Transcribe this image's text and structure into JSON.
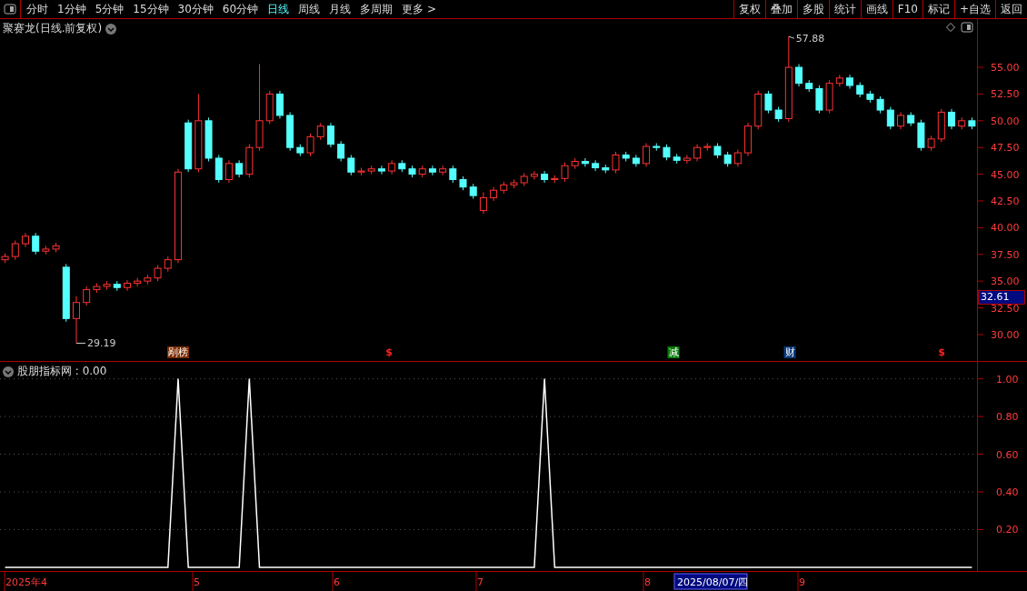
{
  "toolbar": {
    "periods": [
      {
        "label": "分时",
        "selected": false
      },
      {
        "label": "1分钟",
        "selected": false
      },
      {
        "label": "5分钟",
        "selected": false
      },
      {
        "label": "15分钟",
        "selected": false
      },
      {
        "label": "30分钟",
        "selected": false
      },
      {
        "label": "60分钟",
        "selected": false
      },
      {
        "label": "日线",
        "selected": true
      },
      {
        "label": "周线",
        "selected": false
      },
      {
        "label": "月线",
        "selected": false
      },
      {
        "label": "多周期",
        "selected": false
      },
      {
        "label": "更多 >",
        "selected": false
      }
    ],
    "buttons": [
      "复权",
      "叠加",
      "多股",
      "统计",
      "画线",
      "F10",
      "标记",
      "+自选",
      "返回"
    ]
  },
  "price_panel": {
    "title": "聚赛龙(日线.前复权)",
    "high_label": "57.88",
    "low_label": "29.19",
    "events": [
      {
        "label": "剐榜",
        "kind": "list"
      },
      {
        "label": "$",
        "kind": "dollar"
      },
      {
        "label": "减",
        "kind": "reduce"
      },
      {
        "label": "财",
        "kind": "finance"
      },
      {
        "label": "$",
        "kind": "dollar"
      }
    ],
    "current_price": "32.61",
    "chart_data": {
      "type": "candlestick",
      "ylim": [
        27.53,
        59.51
      ],
      "yticks": [
        {
          "value": 55,
          "label": "55.00"
        },
        {
          "value": 52.5,
          "label": "52.50"
        },
        {
          "value": 50,
          "label": "50.00"
        },
        {
          "value": 47.5,
          "label": "47.50"
        },
        {
          "value": 45,
          "label": "45.00"
        },
        {
          "value": 42.5,
          "label": "42.50"
        },
        {
          "value": 40,
          "label": "40.00"
        },
        {
          "value": 37.5,
          "label": "37.50"
        },
        {
          "value": 35,
          "label": "35.00"
        },
        {
          "value": 32.5,
          "label": "32.50"
        },
        {
          "value": 30,
          "label": "30.00"
        }
      ],
      "ohlc": [
        [
          37,
          37.6,
          36.7,
          37.3
        ],
        [
          37.3,
          38.8,
          37.0,
          38.5
        ],
        [
          38.5,
          39.5,
          38.2,
          39.2
        ],
        [
          39.2,
          39.5,
          37.5,
          37.8
        ],
        [
          37.8,
          38.3,
          37.5,
          38.0
        ],
        [
          38.0,
          38.6,
          37.7,
          38.3
        ],
        [
          36.3,
          36.6,
          31.2,
          31.5
        ],
        [
          31.5,
          33.6,
          29.19,
          33.0
        ],
        [
          33.0,
          34.5,
          32.7,
          34.2
        ],
        [
          34.2,
          34.8,
          33.9,
          34.5
        ],
        [
          34.5,
          35.0,
          34.2,
          34.7
        ],
        [
          34.7,
          35.0,
          34.1,
          34.4
        ],
        [
          34.4,
          35.1,
          34.1,
          34.8
        ],
        [
          34.8,
          35.3,
          34.5,
          35.0
        ],
        [
          35.0,
          35.6,
          34.7,
          35.3
        ],
        [
          35.3,
          36.5,
          35.0,
          36.2
        ],
        [
          36.2,
          37.3,
          35.9,
          37.0
        ],
        [
          37.0,
          45.5,
          36.7,
          45.2
        ],
        [
          49.8,
          50.1,
          45.2,
          45.5
        ],
        [
          45.5,
          52.5,
          45.2,
          50.0
        ],
        [
          50.0,
          50.3,
          46.2,
          46.5
        ],
        [
          46.5,
          46.8,
          44.2,
          44.5
        ],
        [
          44.5,
          46.3,
          44.2,
          46.0
        ],
        [
          46.0,
          46.3,
          44.7,
          45.0
        ],
        [
          45.0,
          47.8,
          44.7,
          47.5
        ],
        [
          47.5,
          55.3,
          47.2,
          50.0
        ],
        [
          50.0,
          52.8,
          49.7,
          52.5
        ],
        [
          52.5,
          52.8,
          50.2,
          50.5
        ],
        [
          50.5,
          50.8,
          47.2,
          47.5
        ],
        [
          47.5,
          47.8,
          46.7,
          47.0
        ],
        [
          47.0,
          48.8,
          46.7,
          48.5
        ],
        [
          48.5,
          49.8,
          48.2,
          49.5
        ],
        [
          49.5,
          49.8,
          47.5,
          47.8
        ],
        [
          47.8,
          48.1,
          46.2,
          46.5
        ],
        [
          46.5,
          46.8,
          44.9,
          45.2
        ],
        [
          45.2,
          45.6,
          44.9,
          45.3
        ],
        [
          45.3,
          45.8,
          45.0,
          45.5
        ],
        [
          45.5,
          45.8,
          45.0,
          45.3
        ],
        [
          45.3,
          46.3,
          45.0,
          46.0
        ],
        [
          46.0,
          46.3,
          45.2,
          45.5
        ],
        [
          45.5,
          45.8,
          44.7,
          45.0
        ],
        [
          45.0,
          45.8,
          44.7,
          45.5
        ],
        [
          45.5,
          45.8,
          44.9,
          45.2
        ],
        [
          45.2,
          45.8,
          44.9,
          45.5
        ],
        [
          45.5,
          45.8,
          44.2,
          44.5
        ],
        [
          44.5,
          44.8,
          43.5,
          43.8
        ],
        [
          43.8,
          44.1,
          42.7,
          43.0
        ],
        [
          41.6,
          43.3,
          41.3,
          42.8
        ],
        [
          42.8,
          43.8,
          42.5,
          43.5
        ],
        [
          43.5,
          44.3,
          43.2,
          44.0
        ],
        [
          44.0,
          44.5,
          43.7,
          44.2
        ],
        [
          44.2,
          45.1,
          43.9,
          44.8
        ],
        [
          44.8,
          45.3,
          44.5,
          45.0
        ],
        [
          45.0,
          45.3,
          44.2,
          44.5
        ],
        [
          44.5,
          44.9,
          44.2,
          44.6
        ],
        [
          44.6,
          46.1,
          44.3,
          45.8
        ],
        [
          45.8,
          46.5,
          45.5,
          46.2
        ],
        [
          46.2,
          46.5,
          45.7,
          46.0
        ],
        [
          46.0,
          46.3,
          45.3,
          45.6
        ],
        [
          45.6,
          45.9,
          45.1,
          45.4
        ],
        [
          45.4,
          47.1,
          45.1,
          46.8
        ],
        [
          46.8,
          47.1,
          46.2,
          46.5
        ],
        [
          46.5,
          46.8,
          45.7,
          46.0
        ],
        [
          46.0,
          47.9,
          45.7,
          47.6
        ],
        [
          47.6,
          47.9,
          47.2,
          47.5
        ],
        [
          47.5,
          47.8,
          46.3,
          46.6
        ],
        [
          46.6,
          46.9,
          46.0,
          46.3
        ],
        [
          46.3,
          46.8,
          46.0,
          46.5
        ],
        [
          46.5,
          47.8,
          46.2,
          47.5
        ],
        [
          47.5,
          47.9,
          47.2,
          47.6
        ],
        [
          47.6,
          47.9,
          46.5,
          46.8
        ],
        [
          46.8,
          47.1,
          45.7,
          46.0
        ],
        [
          46.0,
          47.3,
          45.7,
          47.0
        ],
        [
          47.0,
          49.8,
          46.7,
          49.5
        ],
        [
          49.5,
          52.8,
          49.2,
          52.5
        ],
        [
          52.5,
          52.8,
          50.7,
          51.0
        ],
        [
          51.0,
          51.3,
          49.9,
          50.2
        ],
        [
          50.2,
          57.88,
          49.9,
          55.0
        ],
        [
          55.0,
          55.3,
          53.2,
          53.5
        ],
        [
          53.5,
          53.8,
          52.7,
          53.0
        ],
        [
          53.0,
          53.3,
          50.7,
          51.0
        ],
        [
          51.0,
          53.8,
          50.7,
          53.5
        ],
        [
          53.5,
          54.3,
          53.2,
          54.0
        ],
        [
          54.0,
          54.3,
          53.0,
          53.3
        ],
        [
          53.3,
          53.6,
          52.2,
          52.5
        ],
        [
          52.5,
          52.8,
          51.7,
          52.0
        ],
        [
          52.0,
          52.3,
          50.7,
          51.0
        ],
        [
          51.0,
          51.3,
          49.2,
          49.5
        ],
        [
          49.5,
          50.8,
          49.2,
          50.5
        ],
        [
          50.5,
          50.8,
          49.5,
          49.8
        ],
        [
          49.8,
          50.1,
          47.2,
          47.5
        ],
        [
          47.5,
          48.6,
          47.2,
          48.3
        ],
        [
          48.3,
          51.1,
          48.0,
          50.8
        ],
        [
          50.8,
          51.1,
          49.2,
          49.5
        ],
        [
          49.5,
          50.3,
          49.2,
          50.0
        ],
        [
          50.0,
          50.3,
          49.2,
          49.5
        ]
      ]
    }
  },
  "indicator_panel": {
    "title": "股朋指标网 : 0.00",
    "chart_data": {
      "type": "line",
      "ylim": [
        -0.02,
        1.09
      ],
      "grid": true,
      "yticks": [
        {
          "value": 0.2,
          "label": "0.20"
        },
        {
          "value": 0.4,
          "label": "0.40"
        },
        {
          "value": 0.6,
          "label": "0.60"
        },
        {
          "value": 0.8,
          "label": "0.80"
        },
        {
          "value": 1,
          "label": "1.00"
        }
      ],
      "series": [
        {
          "color": "#ffffff",
          "values": [
            0,
            0,
            0,
            0,
            0,
            0,
            0,
            0,
            0,
            0,
            0,
            0,
            0,
            0,
            0,
            0,
            0,
            1,
            0,
            0,
            0,
            0,
            0,
            0,
            1,
            0,
            0,
            0,
            0,
            0,
            0,
            0,
            0,
            0,
            0,
            0,
            0,
            0,
            0,
            0,
            0,
            0,
            0,
            0,
            0,
            0,
            0,
            0,
            0,
            0,
            0,
            0,
            0,
            1,
            0,
            0,
            0,
            0,
            0,
            0,
            0,
            0,
            0,
            0,
            0,
            0,
            0,
            0,
            0,
            0,
            0,
            0,
            0,
            0,
            0,
            0,
            0,
            0,
            0,
            0,
            0,
            0,
            0,
            0,
            0,
            0,
            0,
            0,
            0,
            0,
            0,
            0,
            0,
            0,
            0,
            0
          ]
        }
      ]
    }
  },
  "date_axis": {
    "labels": [
      "2025年4",
      "5",
      "6",
      "7",
      "8",
      "9"
    ],
    "cursor_label": "2025/08/07/四"
  }
}
